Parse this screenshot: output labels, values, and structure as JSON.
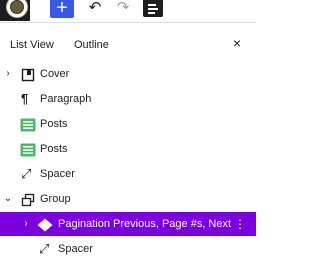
{
  "toolbar": {
    "add_icon": "plus-icon",
    "add_symbol": "+",
    "undo_icon": "undo-icon",
    "undo_symbol": "↶",
    "redo_icon": "redo-icon",
    "redo_symbol": "↷",
    "listview_icon": "list-view-icon",
    "accent_color": "#3858e9"
  },
  "panel": {
    "tabs": [
      "List View",
      "Outline"
    ],
    "close_icon": "close-icon",
    "close_symbol": "×"
  },
  "tree": {
    "items": [
      {
        "label": "Cover",
        "icon": "cover-icon",
        "expander": "›",
        "level": 1
      },
      {
        "label": "Paragraph",
        "icon": "paragraph-icon",
        "glyph": "¶",
        "level": 2
      },
      {
        "label": "Posts",
        "icon": "posts-icon",
        "level": 2
      },
      {
        "label": "Posts",
        "icon": "posts-icon",
        "level": 2
      },
      {
        "label": "Spacer",
        "icon": "spacer-icon",
        "glyph": "⤢",
        "level": 2
      },
      {
        "label": "Group",
        "icon": "group-icon",
        "expander": "⌄",
        "level": 1
      },
      {
        "label": "Pagination Previous, Page #s, Next",
        "icon": "pagination-icon",
        "expander": "›",
        "level": 2,
        "selected": true
      },
      {
        "label": "Spacer",
        "icon": "spacer-icon",
        "glyph": "⤢",
        "level": 3
      }
    ],
    "selected_color": "#7a00df",
    "posts_icon_color": "#4ab866",
    "options_icon": "options-icon",
    "options_symbol": "⋮"
  }
}
